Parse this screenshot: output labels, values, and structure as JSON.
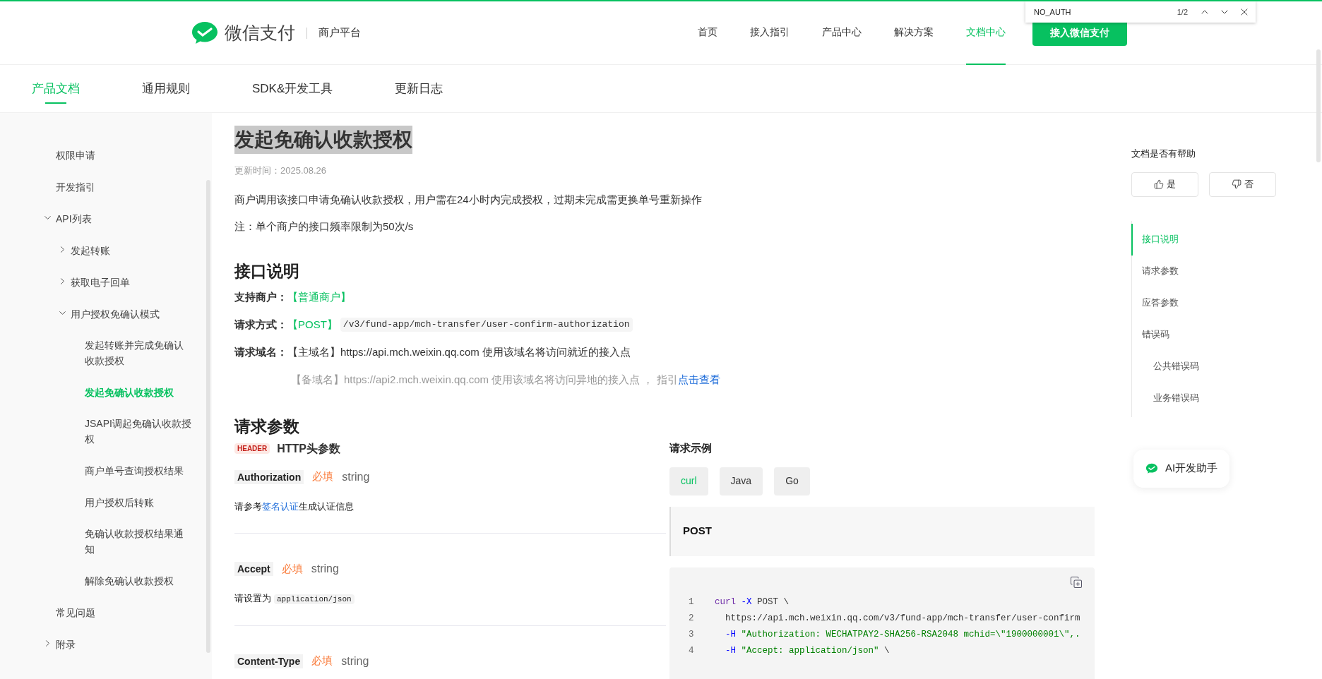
{
  "find_bar": {
    "value": "NO_AUTH",
    "count": "1/2"
  },
  "header": {
    "logo_text": "微信支付",
    "platform": "商户平台",
    "nav": [
      {
        "label": "首页",
        "selected": false
      },
      {
        "label": "接入指引",
        "selected": false
      },
      {
        "label": "产品中心",
        "selected": false
      },
      {
        "label": "解决方案",
        "selected": false
      },
      {
        "label": "文档中心",
        "selected": true
      }
    ],
    "cta": "接入微信支付"
  },
  "tabs": [
    {
      "label": "产品文档",
      "selected": true
    },
    {
      "label": "通用规则",
      "selected": false
    },
    {
      "label": "SDK&开发工具",
      "selected": false
    },
    {
      "label": "更新日志",
      "selected": false
    }
  ],
  "sidebar": {
    "items": [
      {
        "label": "权限申请",
        "selected": false
      },
      {
        "label": "开发指引",
        "selected": false
      },
      {
        "label": "API列表",
        "selected": false,
        "expanded": true,
        "children": [
          {
            "label": "发起转账",
            "selected": false,
            "expanded": false
          },
          {
            "label": "获取电子回单",
            "selected": false,
            "expanded": false
          },
          {
            "label": "用户授权免确认模式",
            "selected": false,
            "expanded": true,
            "children": [
              {
                "label": "发起转账并完成免确认收款授权",
                "selected": false
              },
              {
                "label": "发起免确认收款授权",
                "selected": true
              },
              {
                "label": "JSAPI调起免确认收款授权",
                "selected": false
              },
              {
                "label": "商户单号查询授权结果",
                "selected": false
              },
              {
                "label": "用户授权后转账",
                "selected": false
              },
              {
                "label": "免确认收款授权结果通知",
                "selected": false
              },
              {
                "label": "解除免确认收款授权",
                "selected": false
              }
            ]
          }
        ]
      },
      {
        "label": "常见问题",
        "selected": false
      },
      {
        "label": "附录",
        "selected": false,
        "expanded": false
      }
    ]
  },
  "article": {
    "title": "发起免确认收款授权",
    "updated": "更新时间：2025.08.26",
    "intro": [
      "商户调用该接口申请免确认收款授权，用户需在24小时内完成授权，过期未完成需更换单号重新操作",
      "注：单个商户的接口频率限制为50次/s"
    ],
    "interface": {
      "heading": "接口说明",
      "rows": [
        {
          "kind": "merchant",
          "label": "支持商户：",
          "value": "【普通商户】"
        },
        {
          "kind": "method",
          "label": "请求方式：",
          "method": "【POST】",
          "path": "/v3/fund-app/mch-transfer/user-confirm-authorization"
        },
        {
          "kind": "domain",
          "label": "请求域名：",
          "text": "【主域名】https://api.mch.weixin.qq.com 使用该域名将访问就近的接入点"
        },
        {
          "kind": "backup",
          "text": "【备域名】https://api2.mch.weixin.qq.com 使用该域名将访问异地的接入点 ， 指引",
          "link": "点击查看"
        }
      ]
    },
    "params": {
      "heading": "请求参数",
      "badge": "HEADER",
      "subheading": "HTTP头参数",
      "items": [
        {
          "name": "Authorization",
          "required": "必填",
          "type": "string",
          "desc": [
            {
              "kind": "text",
              "text": "请参考"
            },
            {
              "kind": "link",
              "text": "签名认证"
            },
            {
              "kind": "text",
              "text": "生成认证信息"
            }
          ]
        },
        {
          "name": "Accept",
          "required": "必填",
          "type": "string",
          "desc": [
            {
              "kind": "text",
              "text": "请设置为"
            },
            {
              "kind": "code",
              "text": "application/json"
            }
          ]
        },
        {
          "name": "Content-Type",
          "required": "必填",
          "type": "string"
        }
      ]
    },
    "example": {
      "heading": "请求示例",
      "tabs": [
        {
          "label": "curl",
          "selected": true
        },
        {
          "label": "Java",
          "selected": false
        },
        {
          "label": "Go",
          "selected": false
        }
      ],
      "method": "POST",
      "lines": [
        {
          "number": "1",
          "tokens": [
            {
              "kind": "command",
              "text": "curl"
            },
            {
              "kind": "flag",
              "text": " -X"
            },
            {
              "kind": "plain",
              "text": " POST \\"
            }
          ]
        },
        {
          "number": "2",
          "tokens": [
            {
              "kind": "plain",
              "text": "  https://api.mch.weixin.qq.com/v3/fund-app/mch-transfer/user-confirm"
            }
          ]
        },
        {
          "number": "3",
          "tokens": [
            {
              "kind": "flag",
              "text": "  -H"
            },
            {
              "kind": "string",
              "text": " \"Authorization: WECHATPAY2-SHA256-RSA2048 mchid=\\\"1900000001\\\",."
            }
          ]
        },
        {
          "number": "4",
          "tokens": [
            {
              "kind": "flag",
              "text": "  -H"
            },
            {
              "kind": "string",
              "text": " \"Accept: application/json\""
            },
            {
              "kind": "plain",
              "text": " \\"
            }
          ]
        }
      ]
    }
  },
  "aside": {
    "feedback": {
      "question": "文档是否有帮助",
      "yes": "是",
      "no": "否"
    },
    "toc": [
      {
        "label": "接口说明",
        "selected": true
      },
      {
        "label": "请求参数",
        "selected": false
      },
      {
        "label": "应答参数",
        "selected": false
      },
      {
        "label": "错误码",
        "selected": false,
        "children": [
          {
            "label": "公共错误码",
            "selected": false
          },
          {
            "label": "业务错误码",
            "selected": false
          }
        ]
      }
    ],
    "assistant": "AI开发助手"
  }
}
